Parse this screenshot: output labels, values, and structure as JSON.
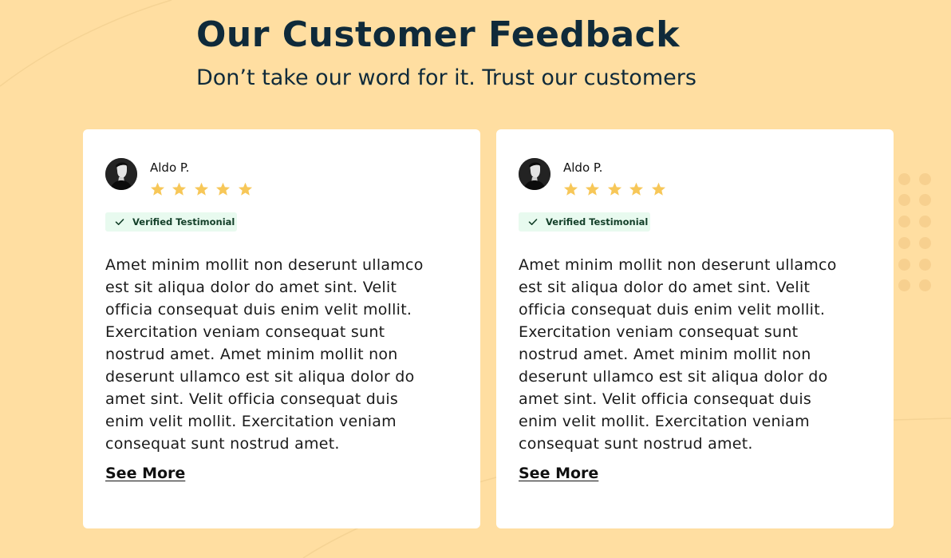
{
  "section": {
    "title": "Our Customer Feedback",
    "subtitle": "Don’t take our word for it. Trust our customers"
  },
  "colors": {
    "background": "#ffdea1",
    "heading": "#0f2a3a",
    "card": "#ffffff",
    "star": "#f7c758",
    "badge_bg": "#e8faef",
    "badge_text": "#14402a"
  },
  "testimonials": [
    {
      "name": "Aldo P.",
      "rating": 5,
      "rating_max": 5,
      "avatar_icon": "person-avatar-icon",
      "badge_icon": "check-icon",
      "badge": "Verified Testimonial",
      "text": "Amet minim mollit non deserunt ullamco est sit aliqua dolor do amet sint. Velit officia consequat duis enim velit mollit. Exercitation veniam consequat sunt nostrud amet. Amet minim mollit non deserunt ullamco est sit aliqua dolor do amet sint. Velit officia consequat duis enim velit mollit. Exercitation veniam consequat sunt nostrud amet.",
      "see_more": "See More"
    },
    {
      "name": "Aldo P.",
      "rating": 5,
      "rating_max": 5,
      "avatar_icon": "person-avatar-icon",
      "badge_icon": "check-icon",
      "badge": "Verified Testimonial",
      "text": "Amet minim mollit non deserunt ullamco est sit aliqua dolor do amet sint. Velit officia consequat duis enim velit mollit. Exercitation veniam consequat sunt nostrud amet. Amet minim mollit non deserunt ullamco est sit aliqua dolor do amet sint. Velit officia consequat duis enim velit mollit. Exercitation veniam consequat sunt nostrud amet.",
      "see_more": "See More"
    }
  ]
}
